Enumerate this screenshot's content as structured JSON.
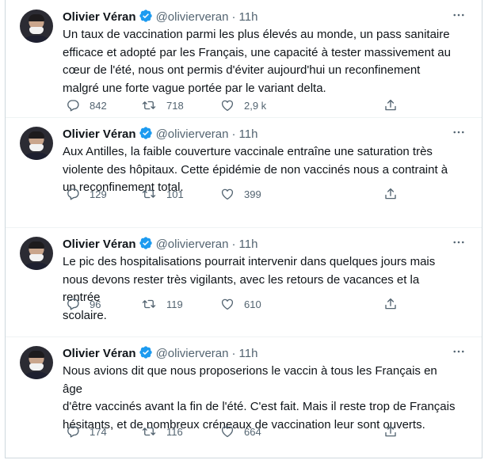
{
  "author": {
    "name": "Olivier Véran",
    "handle": "@olivierveran",
    "separator": "·"
  },
  "colors": {
    "verified": "#1d9bf0",
    "muted": "#536471",
    "text": "#0f1419"
  },
  "tweets": [
    {
      "time": "11h",
      "text": "Un taux de vaccination parmi les plus élevés au monde, un pass sanitaire\nefficace et adopté par les Français, une capacité à tester massivement au\ncœur de l'été, nous ont permis d'éviter aujourd'hui un reconfinement\nmalgré une forte vague portée par le variant delta.",
      "replies": "842",
      "retweets": "718",
      "likes": "2,9 k"
    },
    {
      "time": "11h",
      "text": "Aux Antilles, la faible couverture vaccinale entraîne une saturation très\nviolente des hôpitaux. Cette épidémie de non vaccinés nous a contraint à\nun reconfinement total.",
      "replies": "129",
      "retweets": "101",
      "likes": "399"
    },
    {
      "time": "11h",
      "text": "Le pic des hospitalisations pourrait intervenir dans quelques jours mais\nnous devons rester très vigilants, avec les retours de vacances et la rentrée\nscolaire.",
      "replies": "96",
      "retweets": "119",
      "likes": "610"
    },
    {
      "time": "11h",
      "text": "Nous avions dit que nous proposerions le vaccin à tous les Français en âge\nd'être vaccinés avant la fin de l'été. C'est fait. Mais il reste trop de Français\nhésitants, et de nombreux créneaux de vaccination leur sont ouverts.",
      "replies": "174",
      "retweets": "116",
      "likes": "664"
    }
  ],
  "icons": {
    "verified": "verified-badge-icon",
    "more": "more-options-icon",
    "reply": "reply-icon",
    "retweet": "retweet-icon",
    "like": "heart-icon",
    "share": "share-icon"
  }
}
